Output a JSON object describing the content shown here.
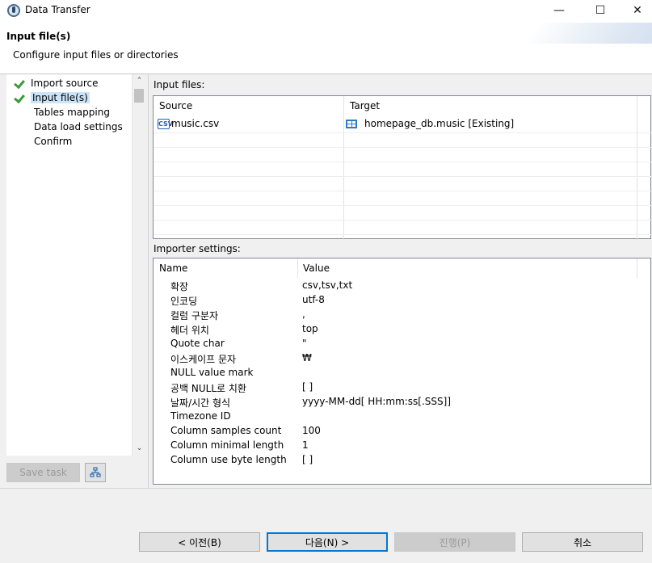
{
  "window": {
    "title": "Data Transfer",
    "minimize": "—",
    "maximize": "☐",
    "close": "✕"
  },
  "header": {
    "title": "Input file(s)",
    "description": "Configure input files or directories"
  },
  "nav": {
    "items": [
      {
        "label": "Import source",
        "checked": true
      },
      {
        "label": "Input file(s)",
        "checked": true,
        "selected": true
      },
      {
        "label": "Tables mapping",
        "checked": false
      },
      {
        "label": "Data load settings",
        "checked": false
      },
      {
        "label": "Confirm",
        "checked": false
      }
    ],
    "scroll_up": "⌃",
    "scroll_down": "⌄"
  },
  "left_buttons": {
    "save_task": "Save task"
  },
  "input_files": {
    "label": "Input files:",
    "columns": [
      "Source",
      "Target"
    ],
    "rows": [
      {
        "source_icon": "CSV",
        "source": "music.csv",
        "target": "homepage_db.music [Existing]"
      }
    ]
  },
  "importer": {
    "label": "Importer settings:",
    "columns": [
      "Name",
      "Value"
    ],
    "rows": [
      {
        "name": "확장",
        "value": "csv,tsv,txt"
      },
      {
        "name": "인코딩",
        "value": "utf-8"
      },
      {
        "name": "컬럼 구분자",
        "value": ","
      },
      {
        "name": "헤더 위치",
        "value": "top"
      },
      {
        "name": "Quote char",
        "value": "\""
      },
      {
        "name": "이스케이프 문자",
        "value": "₩"
      },
      {
        "name": "NULL value mark",
        "value": ""
      },
      {
        "name": "공백 NULL로 치환",
        "value": "[ ]"
      },
      {
        "name": "날짜/시간 형식",
        "value": "yyyy-MM-dd[ HH:mm:ss[.SSS]]"
      },
      {
        "name": "Timezone ID",
        "value": ""
      },
      {
        "name": "Column samples count",
        "value": "100"
      },
      {
        "name": "Column minimal length",
        "value": "1"
      },
      {
        "name": "Column use byte length",
        "value": "[ ]"
      }
    ]
  },
  "footer": {
    "back": "< 이전(B)",
    "next": "다음(N) >",
    "finish": "진행(P)",
    "cancel": "취소"
  }
}
